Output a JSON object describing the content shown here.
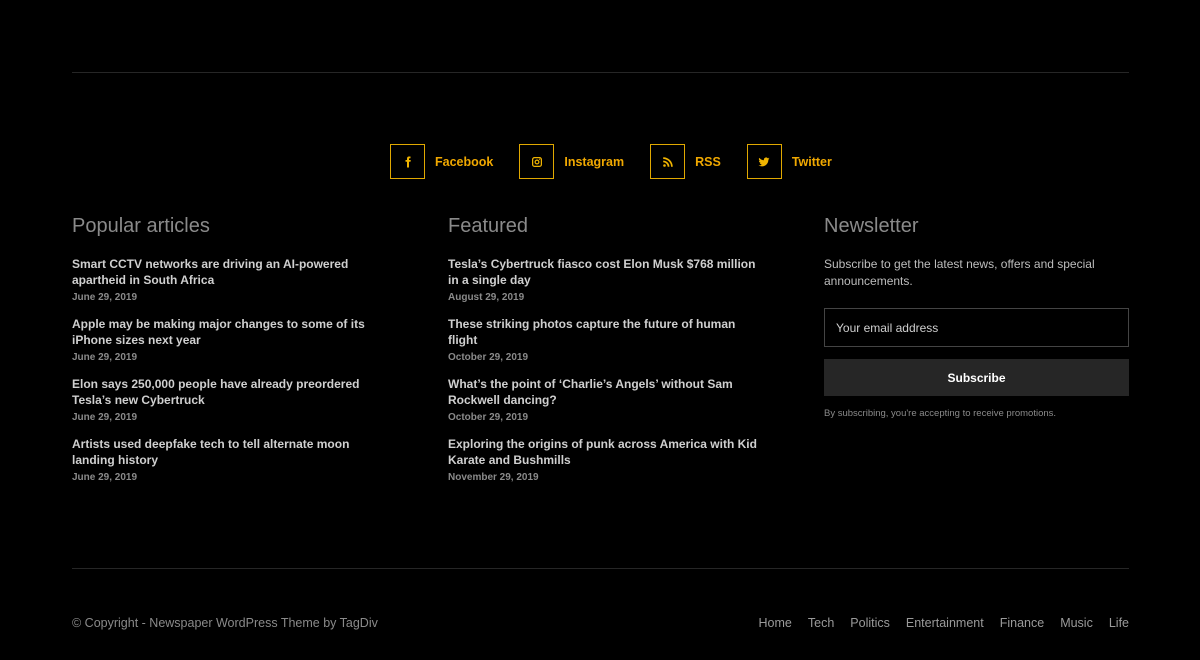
{
  "social": [
    {
      "label": "Facebook",
      "icon": "facebook-icon"
    },
    {
      "label": "Instagram",
      "icon": "instagram-icon"
    },
    {
      "label": "RSS",
      "icon": "rss-icon"
    },
    {
      "label": "Twitter",
      "icon": "twitter-icon"
    }
  ],
  "popular": {
    "title": "Popular articles",
    "articles": [
      {
        "title": "Smart CCTV networks are driving an AI-powered apartheid in South Africa",
        "date": "June 29, 2019"
      },
      {
        "title": "Apple may be making major changes to some of its iPhone sizes next year",
        "date": "June 29, 2019"
      },
      {
        "title": "Elon says 250,000 people have already preordered Tesla’s new Cybertruck",
        "date": "June 29, 2019"
      },
      {
        "title": "Artists used deepfake tech to tell alternate moon landing history",
        "date": "June 29, 2019"
      }
    ]
  },
  "featured": {
    "title": "Featured",
    "articles": [
      {
        "title": "Tesla’s Cybertruck fiasco cost Elon Musk $768 million in a single day",
        "date": "August 29, 2019"
      },
      {
        "title": "These striking photos capture the future of human flight",
        "date": "October 29, 2019"
      },
      {
        "title": "What’s the point of ‘Charlie’s Angels’ without Sam Rockwell dancing?",
        "date": "October 29, 2019"
      },
      {
        "title": "Exploring the origins of punk across America with Kid Karate and Bushmills",
        "date": "November 29, 2019"
      }
    ]
  },
  "newsletter": {
    "title": "Newsletter",
    "description": "Subscribe to get the latest news, offers and special announcements.",
    "email_placeholder": "Your email address",
    "subscribe_label": "Subscribe",
    "note": "By subscribing, you're accepting to receive promotions."
  },
  "footer": {
    "copyright": "© Copyright - Newspaper WordPress Theme by TagDiv",
    "nav": [
      "Home",
      "Tech",
      "Politics",
      "Entertainment",
      "Finance",
      "Music",
      "Life"
    ]
  },
  "colors": {
    "accent": "#f0a800",
    "background": "#000000"
  }
}
